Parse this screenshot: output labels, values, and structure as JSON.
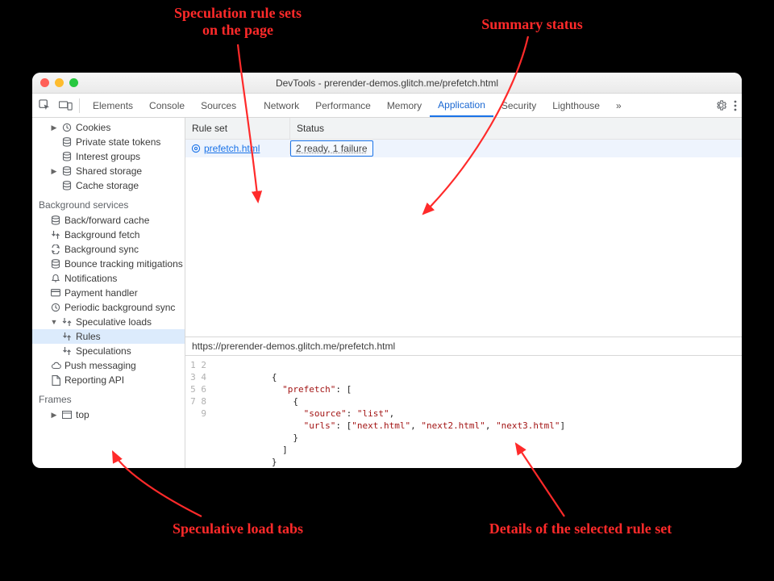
{
  "window": {
    "title": "DevTools - prerender-demos.glitch.me/prefetch.html"
  },
  "tabs": {
    "items": [
      "Elements",
      "Console",
      "Sources",
      "Network",
      "Performance",
      "Memory",
      "Application",
      "Security",
      "Lighthouse"
    ],
    "selected_index": 6,
    "more_glyph": "»"
  },
  "sidebar": {
    "storage": [
      {
        "name": "cookies",
        "label": "Cookies",
        "icon": "clock-icon",
        "expandable": true
      },
      {
        "name": "private-state-tokens",
        "label": "Private state tokens",
        "icon": "db-icon"
      },
      {
        "name": "interest-groups",
        "label": "Interest groups",
        "icon": "db-icon"
      },
      {
        "name": "shared-storage",
        "label": "Shared storage",
        "icon": "db-icon",
        "expandable": true
      },
      {
        "name": "cache-storage",
        "label": "Cache storage",
        "icon": "db-icon"
      }
    ],
    "bg_head": "Background services",
    "bg": [
      {
        "name": "back-forward-cache",
        "label": "Back/forward cache",
        "icon": "db-icon"
      },
      {
        "name": "background-fetch",
        "label": "Background fetch",
        "icon": "arrows-icon"
      },
      {
        "name": "background-sync",
        "label": "Background sync",
        "icon": "sync-icon"
      },
      {
        "name": "bounce-tracking",
        "label": "Bounce tracking mitigations",
        "icon": "db-icon"
      },
      {
        "name": "notifications",
        "label": "Notifications",
        "icon": "bell-icon"
      },
      {
        "name": "payment-handler",
        "label": "Payment handler",
        "icon": "card-icon"
      },
      {
        "name": "periodic-sync",
        "label": "Periodic background sync",
        "icon": "clock-icon"
      }
    ],
    "spec": {
      "root": "Speculative loads",
      "children": [
        {
          "name": "rules",
          "label": "Rules",
          "icon": "arrows-icon",
          "selected": true
        },
        {
          "name": "speculations",
          "label": "Speculations",
          "icon": "arrows-icon"
        }
      ]
    },
    "extra": [
      {
        "name": "push-messaging",
        "label": "Push messaging",
        "icon": "cloud-icon"
      },
      {
        "name": "reporting-api",
        "label": "Reporting API",
        "icon": "doc-icon"
      }
    ],
    "frames_head": "Frames",
    "frames_top": "top"
  },
  "table": {
    "col_rule": "Rule set",
    "col_status": "Status",
    "rows": [
      {
        "rule": "prefetch.html",
        "status": "2 ready, 1 failure"
      }
    ]
  },
  "detail_url": "https://prerender-demos.glitch.me/prefetch.html",
  "code": {
    "lines": [
      "",
      "           {",
      "             \"prefetch\": [",
      "               {",
      "                 \"source\": \"list\",",
      "                 \"urls\": [\"next.html\", \"next2.html\", \"next3.html\"]",
      "               }",
      "             ]",
      "           }"
    ]
  },
  "anno": {
    "a1": "Speculation rule sets\non the page",
    "a2": "Summary status",
    "a3": "Speculative load tabs",
    "a4": "Details of the selected rule set"
  }
}
